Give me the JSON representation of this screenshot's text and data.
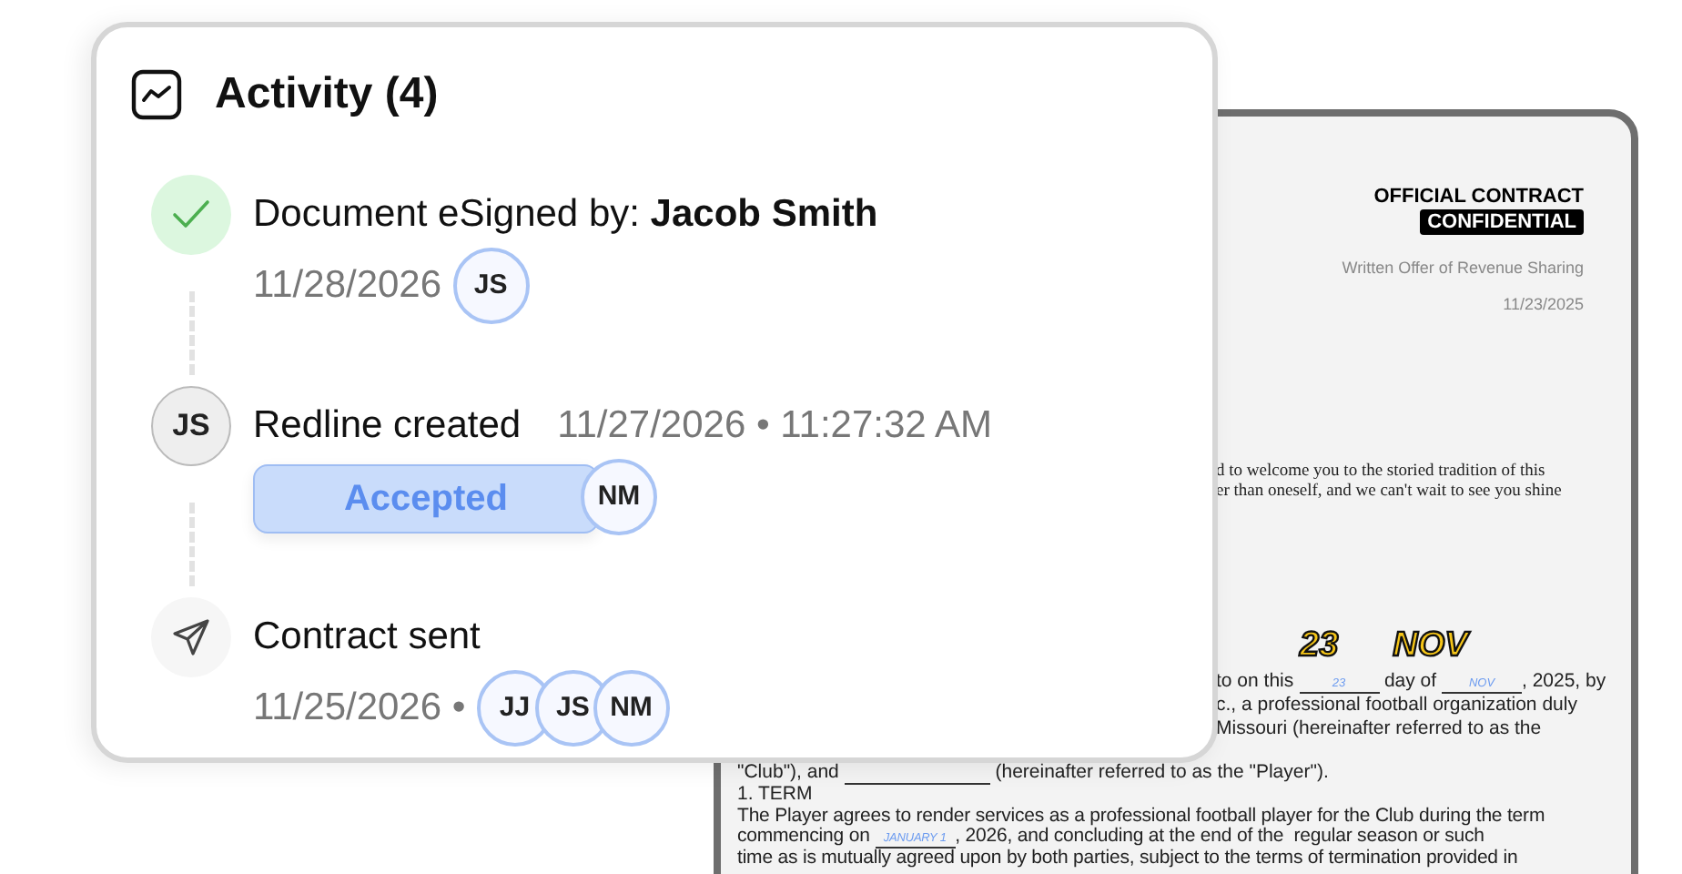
{
  "activity": {
    "title": "Activity (4)",
    "events": [
      {
        "kind": "signed",
        "title": "Document eSigned by: **Jacob Smith**",
        "date": "11/28/2026",
        "avatars": [
          "JS"
        ]
      },
      {
        "kind": "redline",
        "marker": "JS",
        "title": "Redline created",
        "date": "11/27/2026 • 11:27:32 AM",
        "status": "Accepted",
        "avatars": [
          "NM"
        ]
      },
      {
        "kind": "sent",
        "title": "Contract sent",
        "date": "11/25/2026 •",
        "avatars": [
          "JJ",
          "JS",
          "NM"
        ]
      }
    ]
  },
  "document": {
    "heading": "OFFICIAL CONTRACT",
    "badge": "CONFIDENTIAL",
    "subtitle": "Written Offer of Revenue Sharing",
    "date": "11/23/2025",
    "intro_lines": [
      "d to welcome you to the storied tradition of this",
      "er than oneself, and we can't wait to see you shine"
    ],
    "stamps": [
      "23",
      "NOV"
    ],
    "clipped_lines": [
      [
        {
          "kind": "text",
          "text": "to on this "
        },
        {
          "kind": "blank",
          "fill": "23"
        },
        {
          "kind": "text",
          "text": " day of "
        },
        {
          "kind": "blank",
          "fill": "NOV"
        },
        {
          "kind": "text",
          "text": ", 2025, by"
        }
      ],
      [
        {
          "kind": "text",
          "text": "c., a professional football organization duly"
        }
      ],
      [
        {
          "kind": "text",
          "text": "Missouri (hereinafter referred to as the"
        }
      ]
    ],
    "lines": [
      [
        {
          "kind": "text",
          "text": "\"Club\"), and "
        },
        {
          "kind": "blank"
        },
        {
          "kind": "text",
          "text": " (hereinafter referred to as the \"Player\")."
        }
      ]
    ],
    "section": "1. TERM",
    "section_lines": [
      [
        {
          "kind": "text",
          "text": "The Player agrees to render services as a professional football player for the Club during the term"
        }
      ],
      [
        {
          "kind": "text",
          "text": "commencing on "
        },
        {
          "kind": "blank",
          "fill": "JANUARY 1"
        },
        {
          "kind": "text",
          "text": ", 2026, and concluding at the end of the  regular season or such"
        }
      ],
      [
        {
          "kind": "text",
          "text": "time as is mutually agreed upon by both parties, subject to the terms of termination provided in"
        }
      ]
    ]
  }
}
